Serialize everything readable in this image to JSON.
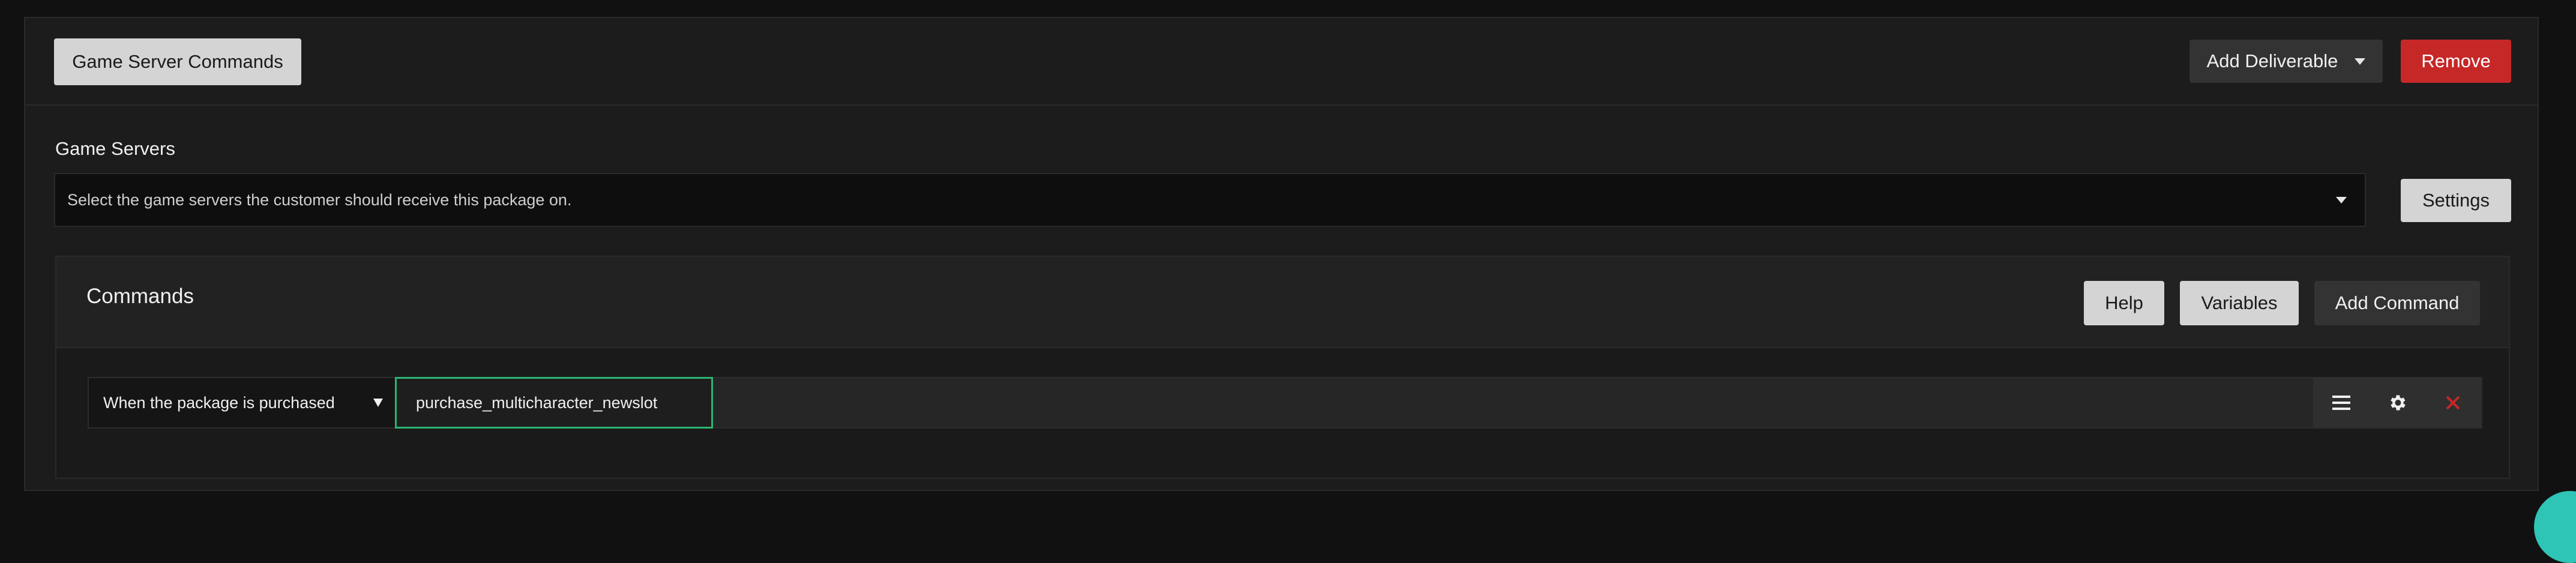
{
  "header": {
    "deliverable_type": "Game Server Commands",
    "add_deliverable_label": "Add Deliverable",
    "remove_label": "Remove"
  },
  "game_servers": {
    "label": "Game Servers",
    "placeholder": "Select the game servers the customer should receive this package on.",
    "settings_label": "Settings"
  },
  "commands": {
    "title": "Commands",
    "help_label": "Help",
    "variables_label": "Variables",
    "add_command_label": "Add Command",
    "rows": [
      {
        "trigger": "When the package is purchased",
        "command": "purchase_multicharacter_newslot"
      }
    ]
  },
  "icons": {
    "menu": "menu-icon",
    "settings": "gear-icon",
    "delete": "close-icon"
  },
  "colors": {
    "accent_green": "#2bb673",
    "danger_red": "#c62828",
    "fab_teal": "#2ec4b6"
  }
}
